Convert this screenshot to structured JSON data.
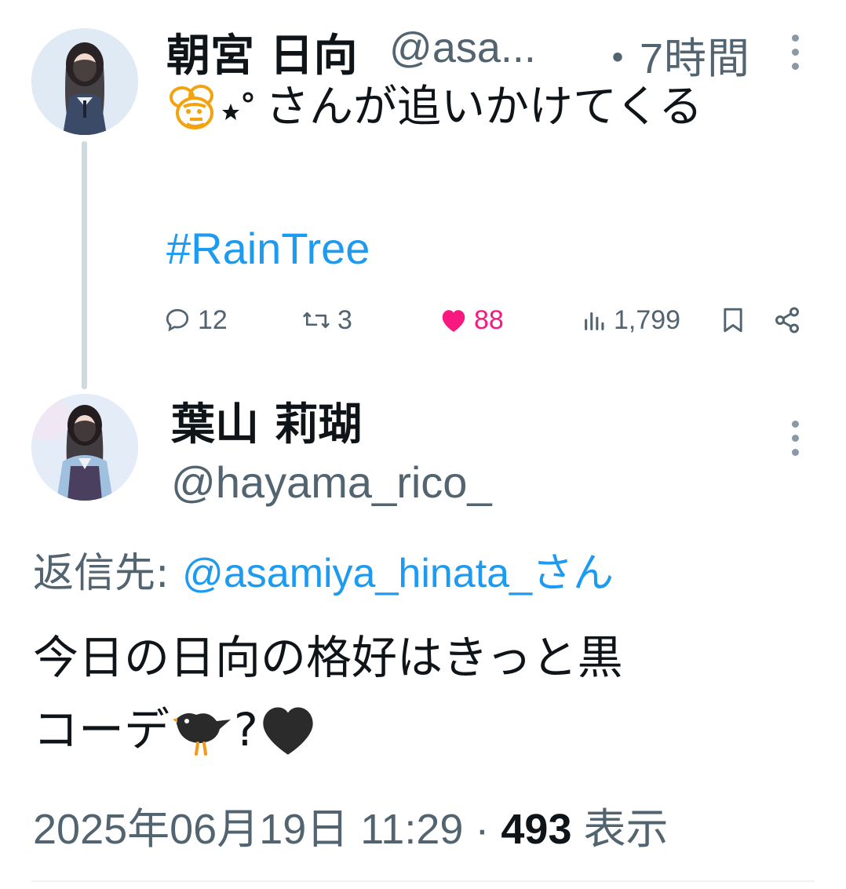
{
  "tweet": {
    "author_name": "朝宮 日向",
    "author_handle": "@asa...",
    "time": "・7時間",
    "line1_text": "さんが追いかけてくる",
    "line1_emoji": [
      "bee-emoji",
      "star-sparkle-emoji"
    ],
    "hashtag": "#RainTree",
    "stats": {
      "replies": "12",
      "retweets": "3",
      "likes": "88",
      "views": "1,799"
    },
    "liked": true,
    "like_color": "#f91880"
  },
  "reply": {
    "author_name": "葉山 莉瑚",
    "author_handle": "@hayama_rico_",
    "reply_to_label": "返信先: ",
    "reply_to_handle": "@asamiya_hinata_さん",
    "text_line1": "今日の日向の格好はきっと黒",
    "text_line2_prefix": "コーデ",
    "text_line2_q": "?",
    "text_line2_emoji": [
      "black-bird-emoji",
      "black-heart-emoji"
    ],
    "date": "2025年06月19日 11:29 · ",
    "view_count": "493",
    "view_label": " 表示"
  },
  "colors": {
    "accent": "#1d9bf0",
    "secondary_text": "#536471",
    "thread_line": "#cfd9de"
  }
}
